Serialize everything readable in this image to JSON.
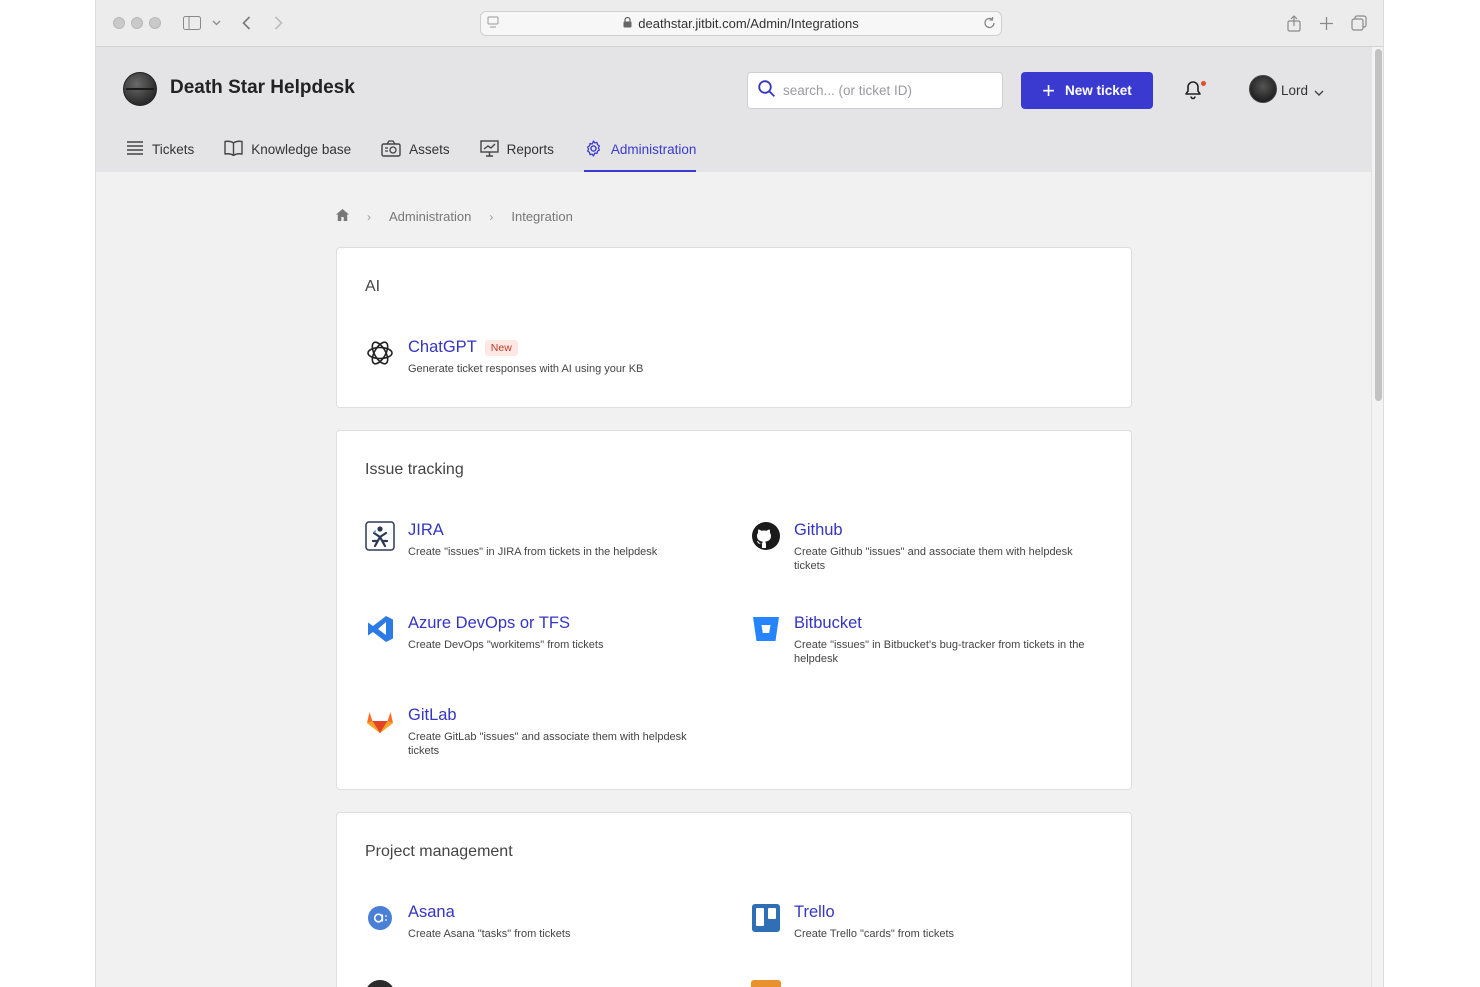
{
  "browser": {
    "url": "deathstar.jitbit.com/Admin/Integrations"
  },
  "header": {
    "app_title": "Death Star Helpdesk",
    "search_placeholder": "search... (or ticket ID)",
    "new_ticket_label": "New ticket",
    "user_name": "Lord"
  },
  "nav": {
    "items": [
      {
        "label": "Tickets",
        "icon": "tickets-icon"
      },
      {
        "label": "Knowledge base",
        "icon": "book-icon"
      },
      {
        "label": "Assets",
        "icon": "assets-icon"
      },
      {
        "label": "Reports",
        "icon": "reports-icon"
      },
      {
        "label": "Administration",
        "icon": "gear-icon",
        "active": true
      }
    ]
  },
  "breadcrumb": {
    "items": [
      "Administration",
      "Integration"
    ]
  },
  "sections": {
    "ai": {
      "title": "AI",
      "items": [
        {
          "name": "ChatGPT",
          "badge": "New",
          "desc": "Generate ticket responses with AI using your KB"
        }
      ]
    },
    "issue_tracking": {
      "title": "Issue tracking",
      "items": [
        {
          "name": "JIRA",
          "desc": "Create \"issues\" in JIRA from tickets in the helpdesk"
        },
        {
          "name": "Github",
          "desc": "Create Github \"issues\" and associate them with helpdesk tickets"
        },
        {
          "name": "Azure DevOps or TFS",
          "desc": "Create DevOps \"workitems\" from tickets"
        },
        {
          "name": "Bitbucket",
          "desc": "Create \"issues\" in Bitbucket's bug-tracker from tickets in the helpdesk"
        },
        {
          "name": "GitLab",
          "desc": "Create GitLab \"issues\" and associate them with helpdesk tickets"
        }
      ]
    },
    "project_management": {
      "title": "Project management",
      "items": [
        {
          "name": "Asana",
          "desc": "Create Asana \"tasks\" from tickets"
        },
        {
          "name": "Trello",
          "desc": "Create Trello \"cards\" from tickets"
        }
      ]
    }
  },
  "colors": {
    "accent": "#3a3ad0",
    "link": "#3535c0",
    "header_bg": "#e4e4e6",
    "page_bg": "#f1f1f2",
    "badge_bg": "#fde8e4",
    "badge_text": "#c0392b",
    "notification_dot": "#e0502b"
  }
}
